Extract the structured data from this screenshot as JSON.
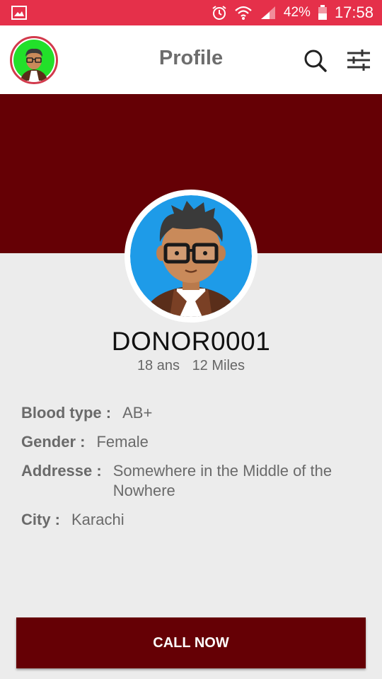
{
  "status_bar": {
    "battery": "42%",
    "time": "17:58",
    "icons": [
      "gallery-icon",
      "alarm-icon",
      "wifi-icon",
      "signal-icon",
      "battery-icon"
    ]
  },
  "app_bar": {
    "title": "Profile",
    "icons": [
      "avatar",
      "search-icon",
      "filter-icon"
    ]
  },
  "profile": {
    "name": "DONOR0001",
    "age": "18 ans",
    "distance": "12 Miles"
  },
  "details": {
    "blood_type_label": "Blood type :",
    "blood_type_value": "AB+",
    "gender_label": "Gender :",
    "gender_value": "Female",
    "address_label": "Addresse :",
    "address_value": "Somewhere in the Middle of the Nowhere",
    "city_label": "City :",
    "city_value": "Karachi"
  },
  "actions": {
    "call_label": "CALL NOW"
  },
  "colors": {
    "status_bar": "#e5304a",
    "banner": "#650005",
    "button": "#650005",
    "avatar_bg_small": "#22e02a",
    "avatar_bg_large": "#1e9be8"
  }
}
